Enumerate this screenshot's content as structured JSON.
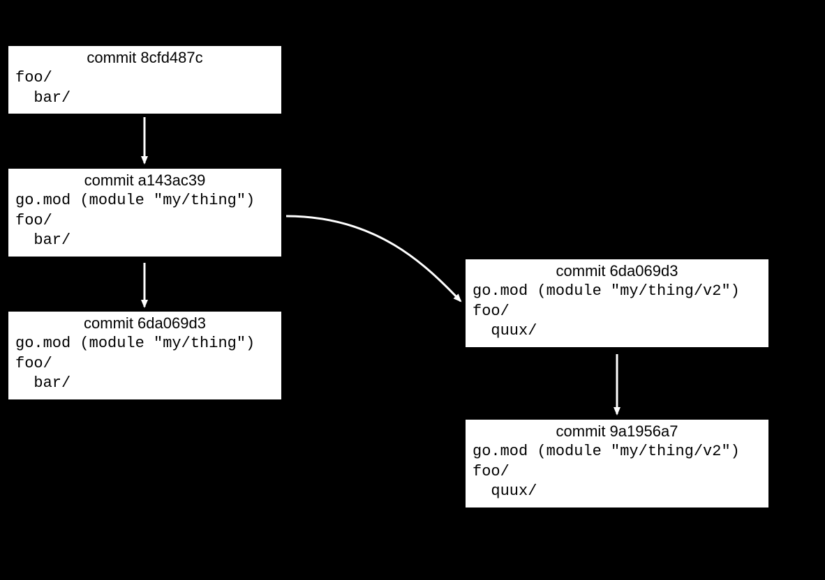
{
  "commits": {
    "c1": {
      "header": "commit 8cfd487c",
      "body": "foo/\n  bar/"
    },
    "c2": {
      "header": "commit a143ac39",
      "body": "go.mod (module \"my/thing\")\nfoo/\n  bar/"
    },
    "c3": {
      "header": "commit 6da069d3",
      "body": "go.mod (module \"my/thing\")\nfoo/\n  bar/"
    },
    "c4": {
      "header": "commit 6da069d3",
      "body": "go.mod (module \"my/thing/v2\")\nfoo/\n  quux/"
    },
    "c5": {
      "header": "commit 9a1956a7",
      "body": "go.mod (module \"my/thing/v2\")\nfoo/\n  quux/"
    }
  }
}
